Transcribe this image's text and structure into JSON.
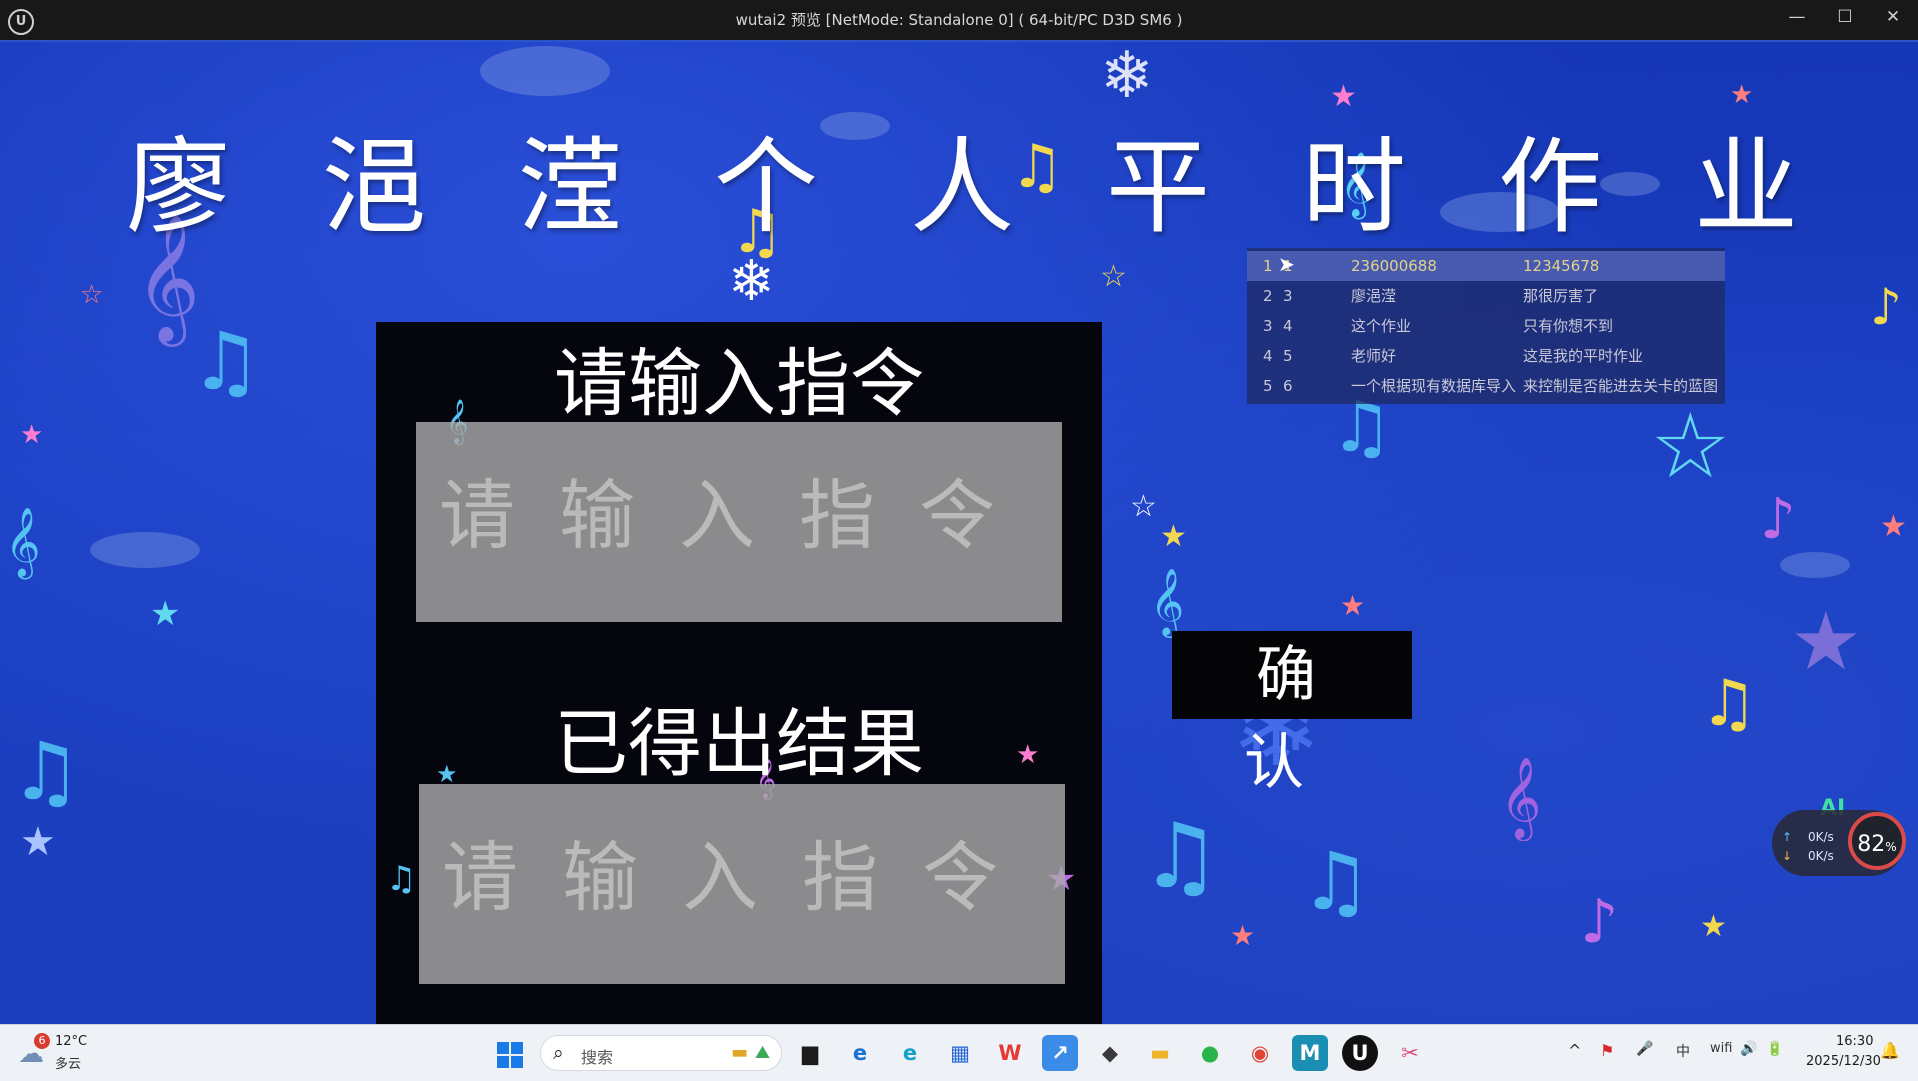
{
  "window": {
    "title": "wutai2 预览 [NetMode: Standalone 0]  ( 64-bit/PC D3D SM6 )",
    "app_icon_glyph": "U",
    "minimize_glyph": "—",
    "maximize_glyph": "☐",
    "close_glyph": "✕"
  },
  "game": {
    "title_chars": [
      "廖",
      "浥",
      "滢",
      "个",
      "人",
      "平",
      "时",
      "作",
      "业"
    ],
    "command_heading": "请输入指令",
    "command_placeholder": "请输入指令",
    "result_heading": "已得出结果",
    "result_placeholder": "请输入指令",
    "confirm_label": "确 认"
  },
  "data_table": {
    "rows": [
      {
        "row": "1",
        "id": "1",
        "col1": "236000688",
        "col2": "12345678"
      },
      {
        "row": "2",
        "id": "3",
        "col1": "廖浥滢",
        "col2": "那很厉害了"
      },
      {
        "row": "3",
        "id": "4",
        "col1": "这个作业",
        "col2": "只有你想不到"
      },
      {
        "row": "4",
        "id": "5",
        "col1": "老师好",
        "col2": "这是我的平时作业"
      },
      {
        "row": "5",
        "id": "6",
        "col1": "一个根据现有数据库导入",
        "col2": "来控制是否能进去关卡的蓝图"
      }
    ]
  },
  "net_widget": {
    "ai_label": "AI",
    "upload": "0K/s",
    "download": "0K/s",
    "percent": "82",
    "percent_unit": "%"
  },
  "taskbar": {
    "weather_badge": "6",
    "weather_temp": "12°C",
    "weather_desc": "多云",
    "search_placeholder": "搜索",
    "clock_time": "16:30",
    "clock_date": "2025/12/30",
    "apps": [
      {
        "name": "file-explorer-app",
        "glyph": "▆",
        "color": "#1b1b1b",
        "bg": "transparent"
      },
      {
        "name": "ie-app",
        "glyph": "e",
        "color": "#1a6fd6",
        "bg": "transparent"
      },
      {
        "name": "edge-app",
        "glyph": "e",
        "color": "#13a0c9",
        "bg": "transparent"
      },
      {
        "name": "store-app",
        "glyph": "▦",
        "color": "#2a6ad8",
        "bg": "transparent"
      },
      {
        "name": "wps-app",
        "glyph": "W",
        "color": "#e53935",
        "bg": "transparent"
      },
      {
        "name": "azure-app",
        "glyph": "↗",
        "color": "#ffffff",
        "bg": "#3b8be8"
      },
      {
        "name": "unity-app",
        "glyph": "◆",
        "color": "#3a3a3a",
        "bg": "transparent"
      },
      {
        "name": "folder-app",
        "glyph": "▬",
        "color": "#f0b428",
        "bg": "transparent"
      },
      {
        "name": "wechat-app",
        "glyph": "●",
        "color": "#2bb34b",
        "bg": "transparent"
      },
      {
        "name": "chrome-app",
        "glyph": "◉",
        "color": "#e04335",
        "bg": "transparent"
      },
      {
        "name": "maya-app",
        "glyph": "M",
        "color": "#ffffff",
        "bg": "#1a8fb3"
      },
      {
        "name": "unreal-app",
        "glyph": "U",
        "color": "#ffffff",
        "bg": "#111111"
      },
      {
        "name": "snipping-app",
        "glyph": "✂",
        "color": "#e0467a",
        "bg": "transparent"
      }
    ],
    "tray": [
      "^",
      "⚑",
      "🎤",
      "中",
      "wifi",
      "🔊",
      "🔋"
    ]
  }
}
